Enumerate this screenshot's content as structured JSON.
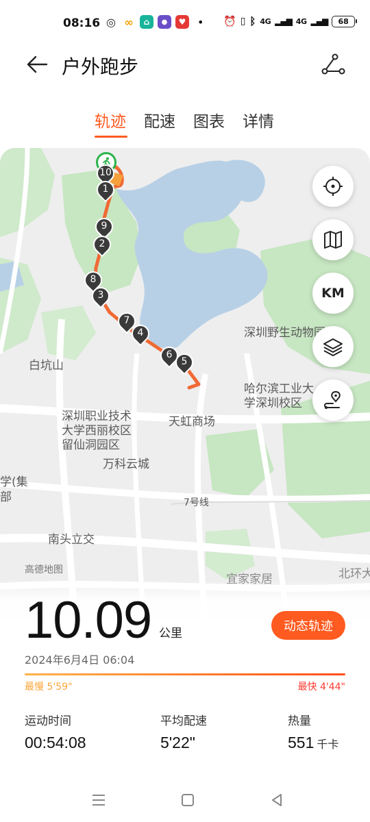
{
  "status_bar": {
    "time": "08:16",
    "app_icons": [
      "target-app-icon",
      "ring-app-icon",
      "home-app-icon",
      "badge-app-icon",
      "red-app-icon"
    ],
    "net_label_1": "4G",
    "net_label_2": "4G",
    "battery": "68"
  },
  "header": {
    "title": "户外跑步"
  },
  "tabs": [
    {
      "label": "轨迹",
      "active": true
    },
    {
      "label": "配速",
      "active": false
    },
    {
      "label": "图表",
      "active": false
    },
    {
      "label": "详情",
      "active": false
    }
  ],
  "map": {
    "labels": {
      "zoo": "深圳野生动物园",
      "baikeng": "白坑山",
      "hit": "哈尔滨工业大学深圳校区",
      "college": "深圳职业技术大学西丽校区留仙洞园区",
      "tianhong": "天虹商场",
      "vanke": "万科云城",
      "line7": "7号线",
      "nantou": "南头立交",
      "gaode": "高德地图",
      "yijia": "宜家家居",
      "beihuan": "北环大",
      "xue": "学(集",
      "bu": "部"
    },
    "markers": [
      "10",
      "1",
      "9",
      "2",
      "8",
      "3",
      "7",
      "4",
      "6",
      "5"
    ],
    "buttons": {
      "km": "KM"
    },
    "route_color": "#f06a35"
  },
  "summary": {
    "distance": "10.09",
    "distance_unit": "公里",
    "dynamic_button": "动态轨迹",
    "datetime": "2024年6月4日 06:04",
    "slowest": "最慢 5'59\"",
    "fastest": "最快 4'44\"",
    "stats": [
      {
        "label": "运动时间",
        "value": "00:54:08",
        "unit": ""
      },
      {
        "label": "平均配速",
        "value": "5'22\"",
        "unit": ""
      },
      {
        "label": "热量",
        "value": "551",
        "unit": "千卡"
      }
    ]
  },
  "colors": {
    "accent": "#ff5a1f",
    "slow": "#ffa53a",
    "fast": "#ff3b2f"
  }
}
